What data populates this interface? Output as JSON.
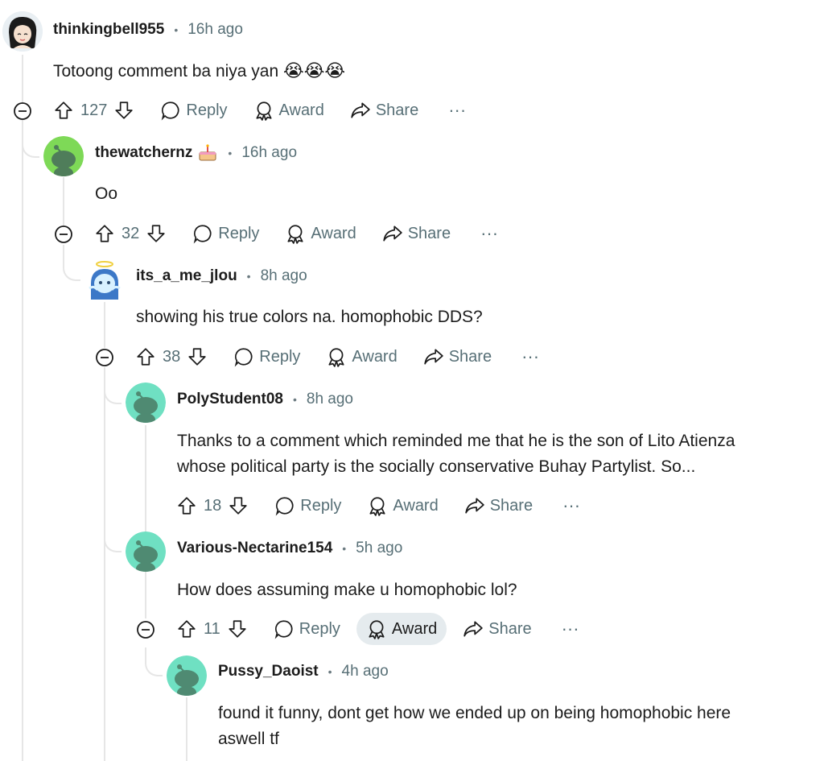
{
  "comments": [
    {
      "user": "thinkingbell955",
      "dot": "•",
      "time": "16h ago",
      "text": "Totoong comment ba niya yan",
      "emoji": "😭😭😭",
      "votes": "127"
    },
    {
      "user": "thewatchernz",
      "dot": "•",
      "time": "16h ago",
      "text": "Oo",
      "votes": "32",
      "flair_icon": "cake-icon"
    },
    {
      "user": "its_a_me_jlou",
      "dot": "•",
      "time": "8h ago",
      "text": "showing his true colors na. homophobic DDS?",
      "votes": "38"
    },
    {
      "user": "PolyStudent08",
      "dot": "•",
      "time": "8h ago",
      "text_line1": "Thanks to a comment which reminded me that he is the son of Lito Atienza",
      "text_line2": "whose political party is the socially conservative Buhay Partylist. So...",
      "votes": "18"
    },
    {
      "user": "Various-Nectarine154",
      "dot": "•",
      "time": "5h ago",
      "text": "How does assuming make u homophobic lol?",
      "votes": "11"
    },
    {
      "user": "Pussy_Daoist",
      "dot": "•",
      "time": "4h ago",
      "text_line1": "found it funny, dont get how we ended up on being homophobic here",
      "text_line2": "aswell tf"
    }
  ],
  "actions": {
    "reply": "Reply",
    "award": "Award",
    "share": "Share",
    "more": "···"
  },
  "colors": {
    "snoo_green": "#6bcf6a",
    "snoo_teal": "#6fe0c2",
    "snoo_body": "#5a8a6e",
    "active_bg": "#e5ebee"
  }
}
